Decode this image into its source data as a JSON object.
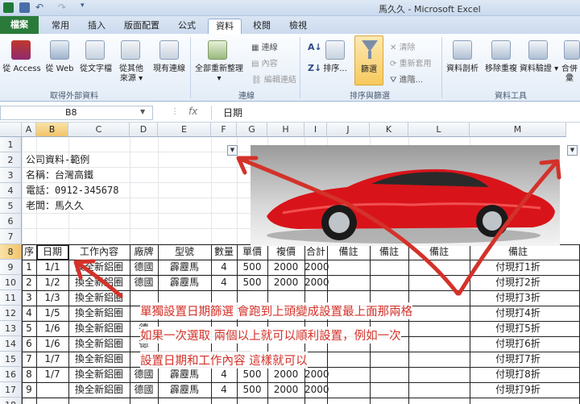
{
  "window": {
    "title": "馬久久 - Microsoft Excel"
  },
  "tabs": [
    "檔案",
    "常用",
    "插入",
    "版面配置",
    "公式",
    "資料",
    "校閱",
    "檢視"
  ],
  "ribbon": {
    "get_external": [
      "從 Access",
      "從 Web",
      "從文字檔",
      "從其他\n來源 ▾",
      "現有連線"
    ],
    "get_external_group": "取得外部資料",
    "refresh_all": "全部重新整理 ▾",
    "conn_small": [
      "連線",
      "內容",
      "編輯連結"
    ],
    "conn_group": "連線",
    "sort_btn": "排序...",
    "filter_btn": "篩選",
    "filter_small": [
      "清除",
      "重新套用",
      "進階..."
    ],
    "sort_group": "排序與篩選",
    "tools": [
      "資料剖析",
      "移除重複",
      "資料驗證 ▾",
      "合併彙"
    ],
    "tools_group": "資料工具"
  },
  "formula": {
    "namebox": "B8",
    "fx": "fx",
    "value": "日期"
  },
  "columns": [
    "A",
    "B",
    "C",
    "D",
    "E",
    "F",
    "G",
    "H",
    "I",
    "J",
    "K",
    "L",
    "M"
  ],
  "rows": [
    "1",
    "2",
    "3",
    "4",
    "5",
    "6",
    "7",
    "8",
    "9",
    "10",
    "11",
    "12",
    "13",
    "14",
    "15",
    "16",
    "17",
    "18"
  ],
  "company": [
    "公司資料-範例",
    "名稱：台灣高鐵",
    "電話：0912-345678",
    "老闆：馬久久"
  ],
  "headers": [
    "序",
    "日期",
    "工作內容",
    "廠牌",
    "型號",
    "數量",
    "單價",
    "複價",
    "合計",
    "備註",
    "備註",
    "備註",
    "備註"
  ],
  "table_rows": [
    {
      "seq": "1",
      "date": "1/1",
      "job": "換全新鋁圈",
      "brand": "德國",
      "model": "霹靂馬",
      "qty": "4",
      "price": "500",
      "ext": "2000",
      "total": "2000",
      "note": "付現打1折"
    },
    {
      "seq": "2",
      "date": "1/2",
      "job": "換全新鋁圈",
      "brand": "德國",
      "model": "霹靂馬",
      "qty": "4",
      "price": "500",
      "ext": "2000",
      "total": "2000",
      "note": "付現打2折"
    },
    {
      "seq": "3",
      "date": "1/3",
      "job": "換全新鋁圈",
      "brand": "",
      "model": "",
      "qty": "",
      "price": "",
      "ext": "",
      "total": "",
      "note": "付現打3折"
    },
    {
      "seq": "4",
      "date": "1/5",
      "job": "換全新鋁圈",
      "brand": "",
      "model": "",
      "qty": "",
      "price": "",
      "ext": "",
      "total": "",
      "note": "付現打4折"
    },
    {
      "seq": "5",
      "date": "1/6",
      "job": "換全新鋁圈",
      "brand": "德",
      "model": "",
      "qty": "",
      "price": "",
      "ext": "",
      "total": "",
      "note": "付現打5折"
    },
    {
      "seq": "6",
      "date": "1/6",
      "job": "換全新鋁圈",
      "brand": "德",
      "model": "",
      "qty": "",
      "price": "",
      "ext": "",
      "total": "",
      "note": "付現打6折"
    },
    {
      "seq": "7",
      "date": "1/7",
      "job": "換全新鋁圈",
      "brand": "",
      "model": "",
      "qty": "",
      "price": "",
      "ext": "",
      "total": "",
      "note": "付現打7折"
    },
    {
      "seq": "8",
      "date": "1/7",
      "job": "換全新鋁圈",
      "brand": "德國",
      "model": "霹靂馬",
      "qty": "4",
      "price": "500",
      "ext": "2000",
      "total": "2000",
      "note": "付現打8折"
    },
    {
      "seq": "9",
      "date": "",
      "job": "換全新鋁圈",
      "brand": "德國",
      "model": "霹靂馬",
      "qty": "4",
      "price": "500",
      "ext": "2000",
      "total": "2000",
      "note": "付現打9折"
    }
  ],
  "annotation": [
    "單獨設置日期篩選 會跑到上頭變成設置最上面那兩格",
    "如果一次選取 兩個以上就可以順利設置，例如一次",
    "設置日期和工作內容  這樣就可以"
  ],
  "colors": {
    "annotation": "#d3322a",
    "excel_green": "#2a7b3a",
    "selection": "#f2c46a"
  }
}
